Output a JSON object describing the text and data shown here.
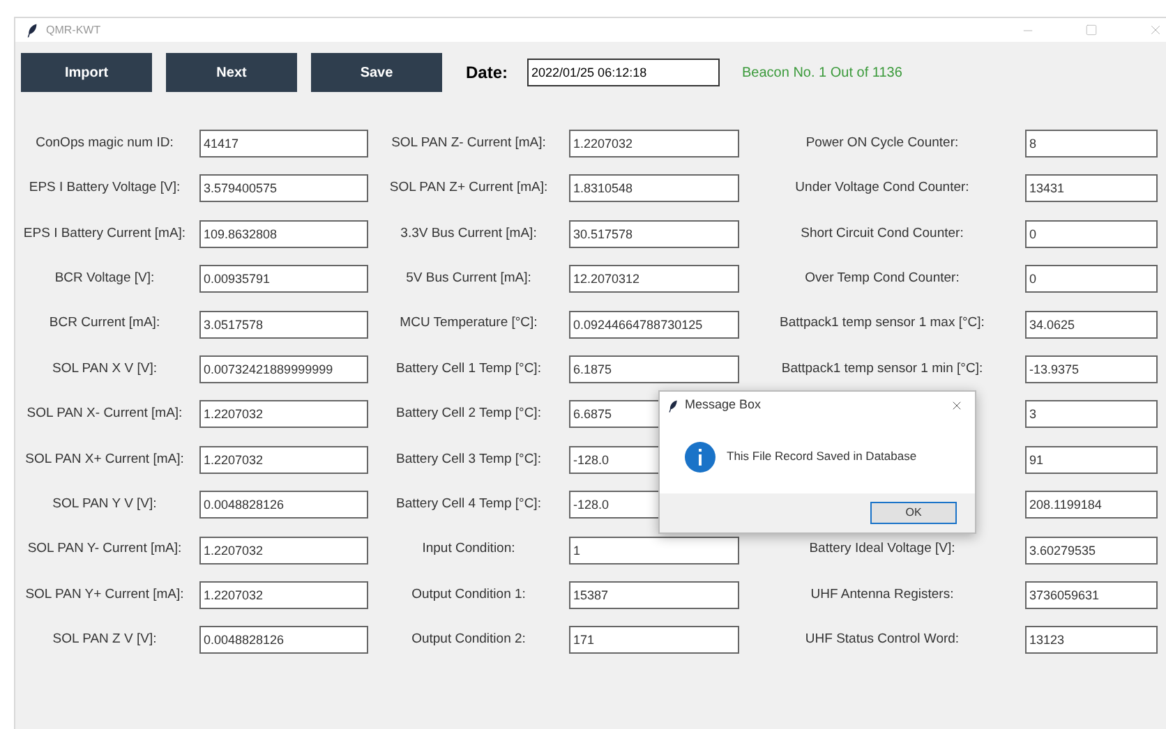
{
  "window": {
    "title": "QMR-KWT"
  },
  "toolbar": {
    "buttons": [
      "Import",
      "Next",
      "Save"
    ],
    "date_label": "Date:",
    "date_value": "2022/01/25 06:12:18",
    "status": "Beacon No. 1 Out of 1136"
  },
  "rows": [
    {
      "cells": [
        {
          "label": "ConOps magic num ID:",
          "value": "41417"
        },
        {
          "label": "SOL PAN Z- Current [mA]:",
          "value": "1.2207032"
        },
        {
          "label": "Power ON Cycle Counter:",
          "value": "8"
        }
      ]
    },
    {
      "cells": [
        {
          "label": "EPS I Battery Voltage [V]:",
          "value": "3.579400575"
        },
        {
          "label": "SOL PAN Z+ Current [mA]:",
          "value": "1.8310548"
        },
        {
          "label": "Under Voltage Cond Counter:",
          "value": "13431"
        }
      ]
    },
    {
      "cells": [
        {
          "label": "EPS I Battery Current [mA]:",
          "value": "109.8632808"
        },
        {
          "label": "3.3V Bus Current [mA]:",
          "value": "30.517578"
        },
        {
          "label": "Short Circuit Cond Counter:",
          "value": "0"
        }
      ]
    },
    {
      "cells": [
        {
          "label": "BCR Voltage [V]:",
          "value": "0.00935791"
        },
        {
          "label": "5V Bus Current [mA]:",
          "value": "12.2070312"
        },
        {
          "label": "Over Temp Cond Counter:",
          "value": "0"
        }
      ]
    },
    {
      "cells": [
        {
          "label": "BCR Current [mA]:",
          "value": "3.0517578"
        },
        {
          "label": "MCU Temperature [°C]:",
          "value": "0.09244664788730125"
        },
        {
          "label": "Battpack1 temp sensor 1 max [°C]:",
          "value": "34.0625"
        }
      ]
    },
    {
      "cells": [
        {
          "label": "SOL PAN X V [V]:",
          "value": "0.00732421889999999"
        },
        {
          "label": "Battery Cell 1 Temp [°C]:",
          "value": "6.1875"
        },
        {
          "label": "Battpack1 temp sensor 1 min [°C]:",
          "value": "-13.9375"
        }
      ]
    },
    {
      "cells": [
        {
          "label": "SOL PAN X- Current [mA]:",
          "value": "1.2207032"
        },
        {
          "label": "Battery Cell 2 Temp [°C]:",
          "value": "6.6875"
        },
        {
          "value": "3"
        }
      ]
    },
    {
      "cells": [
        {
          "label": "SOL PAN X+ Current [mA]:",
          "value": "1.2207032"
        },
        {
          "label": "Battery Cell 3 Temp [°C]:",
          "value": "-128.0"
        },
        {
          "value": "91"
        }
      ]
    },
    {
      "cells": [
        {
          "label": "SOL PAN Y V [V]:",
          "value": "0.0048828126"
        },
        {
          "label": "Battery Cell 4 Temp [°C]:",
          "value": "-128.0"
        },
        {
          "value": "208.1199184"
        }
      ]
    },
    {
      "cells": [
        {
          "label": "SOL PAN Y- Current [mA]:",
          "value": "1.2207032"
        },
        {
          "label": "Input Condition:",
          "value": "1"
        },
        {
          "label": "Battery Ideal Voltage [V]:",
          "value": "3.60279535"
        }
      ]
    },
    {
      "cells": [
        {
          "label": "SOL PAN Y+ Current [mA]:",
          "value": "1.2207032"
        },
        {
          "label": "Output Condition 1:",
          "value": "15387"
        },
        {
          "label": "UHF Antenna Registers:",
          "value": "3736059631"
        }
      ]
    },
    {
      "cells": [
        {
          "label": "SOL PAN Z V [V]:",
          "value": "0.0048828126"
        },
        {
          "label": "Output Condition 2:",
          "value": "171"
        },
        {
          "label": "UHF Status Control Word:",
          "value": "13123"
        }
      ]
    }
  ],
  "dialog": {
    "title": "Message Box",
    "message": "This File Record Saved in Database",
    "button": "OK"
  }
}
